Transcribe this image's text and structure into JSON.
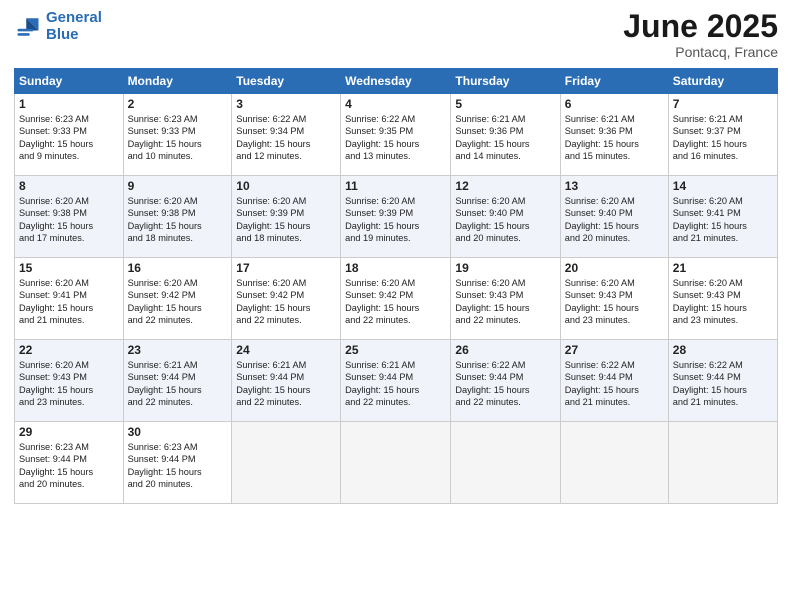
{
  "header": {
    "logo_line1": "General",
    "logo_line2": "Blue",
    "month": "June 2025",
    "location": "Pontacq, France"
  },
  "weekdays": [
    "Sunday",
    "Monday",
    "Tuesday",
    "Wednesday",
    "Thursday",
    "Friday",
    "Saturday"
  ],
  "weeks": [
    [
      {
        "day": "1",
        "lines": [
          "Sunrise: 6:23 AM",
          "Sunset: 9:33 PM",
          "Daylight: 15 hours",
          "and 9 minutes."
        ]
      },
      {
        "day": "2",
        "lines": [
          "Sunrise: 6:23 AM",
          "Sunset: 9:33 PM",
          "Daylight: 15 hours",
          "and 10 minutes."
        ]
      },
      {
        "day": "3",
        "lines": [
          "Sunrise: 6:22 AM",
          "Sunset: 9:34 PM",
          "Daylight: 15 hours",
          "and 12 minutes."
        ]
      },
      {
        "day": "4",
        "lines": [
          "Sunrise: 6:22 AM",
          "Sunset: 9:35 PM",
          "Daylight: 15 hours",
          "and 13 minutes."
        ]
      },
      {
        "day": "5",
        "lines": [
          "Sunrise: 6:21 AM",
          "Sunset: 9:36 PM",
          "Daylight: 15 hours",
          "and 14 minutes."
        ]
      },
      {
        "day": "6",
        "lines": [
          "Sunrise: 6:21 AM",
          "Sunset: 9:36 PM",
          "Daylight: 15 hours",
          "and 15 minutes."
        ]
      },
      {
        "day": "7",
        "lines": [
          "Sunrise: 6:21 AM",
          "Sunset: 9:37 PM",
          "Daylight: 15 hours",
          "and 16 minutes."
        ]
      }
    ],
    [
      {
        "day": "8",
        "lines": [
          "Sunrise: 6:20 AM",
          "Sunset: 9:38 PM",
          "Daylight: 15 hours",
          "and 17 minutes."
        ]
      },
      {
        "day": "9",
        "lines": [
          "Sunrise: 6:20 AM",
          "Sunset: 9:38 PM",
          "Daylight: 15 hours",
          "and 18 minutes."
        ]
      },
      {
        "day": "10",
        "lines": [
          "Sunrise: 6:20 AM",
          "Sunset: 9:39 PM",
          "Daylight: 15 hours",
          "and 18 minutes."
        ]
      },
      {
        "day": "11",
        "lines": [
          "Sunrise: 6:20 AM",
          "Sunset: 9:39 PM",
          "Daylight: 15 hours",
          "and 19 minutes."
        ]
      },
      {
        "day": "12",
        "lines": [
          "Sunrise: 6:20 AM",
          "Sunset: 9:40 PM",
          "Daylight: 15 hours",
          "and 20 minutes."
        ]
      },
      {
        "day": "13",
        "lines": [
          "Sunrise: 6:20 AM",
          "Sunset: 9:40 PM",
          "Daylight: 15 hours",
          "and 20 minutes."
        ]
      },
      {
        "day": "14",
        "lines": [
          "Sunrise: 6:20 AM",
          "Sunset: 9:41 PM",
          "Daylight: 15 hours",
          "and 21 minutes."
        ]
      }
    ],
    [
      {
        "day": "15",
        "lines": [
          "Sunrise: 6:20 AM",
          "Sunset: 9:41 PM",
          "Daylight: 15 hours",
          "and 21 minutes."
        ]
      },
      {
        "day": "16",
        "lines": [
          "Sunrise: 6:20 AM",
          "Sunset: 9:42 PM",
          "Daylight: 15 hours",
          "and 22 minutes."
        ]
      },
      {
        "day": "17",
        "lines": [
          "Sunrise: 6:20 AM",
          "Sunset: 9:42 PM",
          "Daylight: 15 hours",
          "and 22 minutes."
        ]
      },
      {
        "day": "18",
        "lines": [
          "Sunrise: 6:20 AM",
          "Sunset: 9:42 PM",
          "Daylight: 15 hours",
          "and 22 minutes."
        ]
      },
      {
        "day": "19",
        "lines": [
          "Sunrise: 6:20 AM",
          "Sunset: 9:43 PM",
          "Daylight: 15 hours",
          "and 22 minutes."
        ]
      },
      {
        "day": "20",
        "lines": [
          "Sunrise: 6:20 AM",
          "Sunset: 9:43 PM",
          "Daylight: 15 hours",
          "and 23 minutes."
        ]
      },
      {
        "day": "21",
        "lines": [
          "Sunrise: 6:20 AM",
          "Sunset: 9:43 PM",
          "Daylight: 15 hours",
          "and 23 minutes."
        ]
      }
    ],
    [
      {
        "day": "22",
        "lines": [
          "Sunrise: 6:20 AM",
          "Sunset: 9:43 PM",
          "Daylight: 15 hours",
          "and 23 minutes."
        ]
      },
      {
        "day": "23",
        "lines": [
          "Sunrise: 6:21 AM",
          "Sunset: 9:44 PM",
          "Daylight: 15 hours",
          "and 22 minutes."
        ]
      },
      {
        "day": "24",
        "lines": [
          "Sunrise: 6:21 AM",
          "Sunset: 9:44 PM",
          "Daylight: 15 hours",
          "and 22 minutes."
        ]
      },
      {
        "day": "25",
        "lines": [
          "Sunrise: 6:21 AM",
          "Sunset: 9:44 PM",
          "Daylight: 15 hours",
          "and 22 minutes."
        ]
      },
      {
        "day": "26",
        "lines": [
          "Sunrise: 6:22 AM",
          "Sunset: 9:44 PM",
          "Daylight: 15 hours",
          "and 22 minutes."
        ]
      },
      {
        "day": "27",
        "lines": [
          "Sunrise: 6:22 AM",
          "Sunset: 9:44 PM",
          "Daylight: 15 hours",
          "and 21 minutes."
        ]
      },
      {
        "day": "28",
        "lines": [
          "Sunrise: 6:22 AM",
          "Sunset: 9:44 PM",
          "Daylight: 15 hours",
          "and 21 minutes."
        ]
      }
    ],
    [
      {
        "day": "29",
        "lines": [
          "Sunrise: 6:23 AM",
          "Sunset: 9:44 PM",
          "Daylight: 15 hours",
          "and 20 minutes."
        ]
      },
      {
        "day": "30",
        "lines": [
          "Sunrise: 6:23 AM",
          "Sunset: 9:44 PM",
          "Daylight: 15 hours",
          "and 20 minutes."
        ]
      },
      {
        "day": "",
        "lines": []
      },
      {
        "day": "",
        "lines": []
      },
      {
        "day": "",
        "lines": []
      },
      {
        "day": "",
        "lines": []
      },
      {
        "day": "",
        "lines": []
      }
    ]
  ]
}
